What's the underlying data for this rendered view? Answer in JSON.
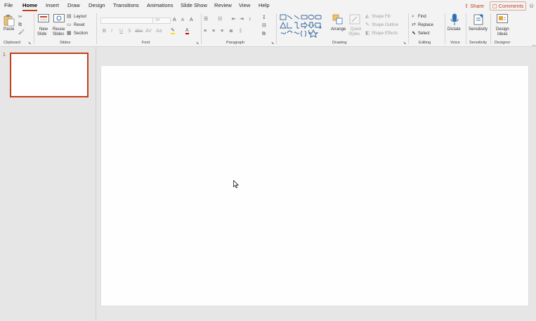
{
  "menu": {
    "tabs": [
      "File",
      "Home",
      "Insert",
      "Draw",
      "Design",
      "Transitions",
      "Animations",
      "Slide Show",
      "Review",
      "View",
      "Help"
    ],
    "active_tab": "Home",
    "share_label": "Share",
    "comments_label": "Comments"
  },
  "ribbon": {
    "clipboard": {
      "paste": "Paste",
      "group": "Clipboard"
    },
    "slides": {
      "new_slide_1": "New",
      "new_slide_2": "Slide",
      "reuse_1": "Reuse",
      "reuse_2": "Slides",
      "layout": "Layout",
      "reset": "Reset",
      "section": "Section",
      "group": "Slides"
    },
    "font": {
      "size": "24",
      "group": "Font"
    },
    "paragraph": {
      "group": "Paragraph"
    },
    "drawing": {
      "arrange": "Arrange",
      "quick_styles_1": "Quick",
      "quick_styles_2": "Styles",
      "shape_fill": "Shape Fill",
      "shape_outline": "Shape Outline",
      "shape_effects": "Shape Effects",
      "group": "Drawing"
    },
    "editing": {
      "find": "Find",
      "replace": "Replace",
      "select": "Select",
      "group": "Editing"
    },
    "voice": {
      "dictate": "Dictate",
      "group": "Voice"
    },
    "sensitivity": {
      "label": "Sensitivity",
      "group": "Sensitivity"
    },
    "designer": {
      "ideas_1": "Design",
      "ideas_2": "Ideas",
      "group": "Designer"
    }
  },
  "thumbnails": {
    "slide_number": "1"
  },
  "colors": {
    "accent": "#c43e1c",
    "ribbon_bg": "#f3f3f3",
    "workspace_bg": "#e6e6e6"
  }
}
